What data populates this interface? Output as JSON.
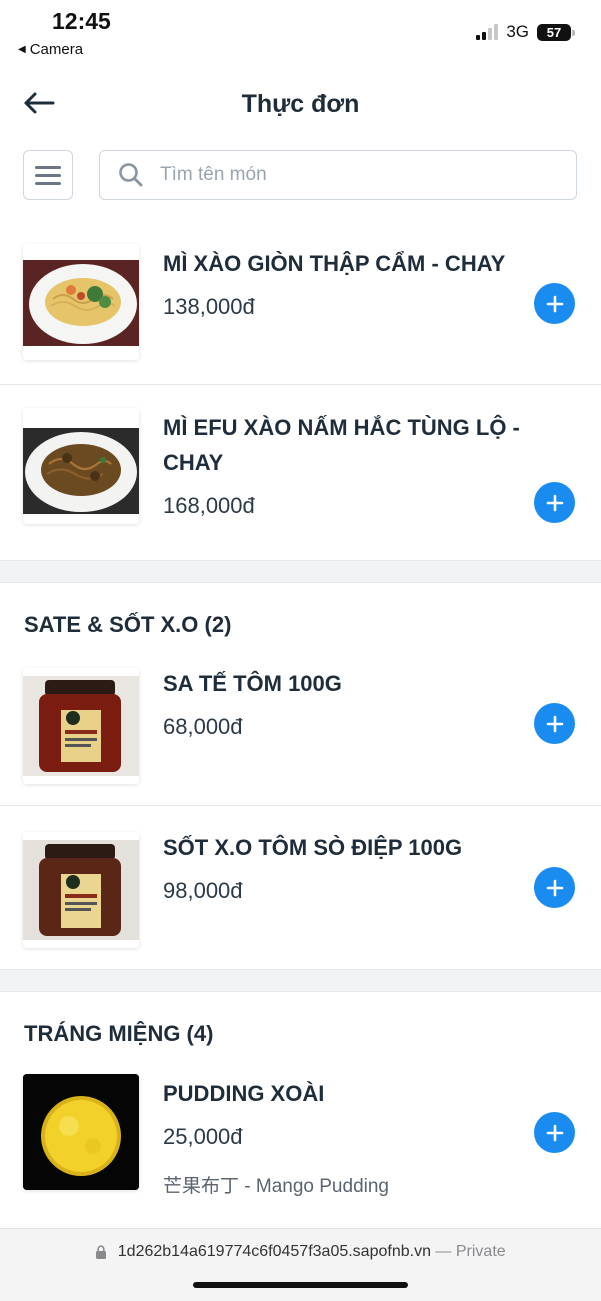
{
  "status_bar": {
    "time": "12:45",
    "back_app": "Camera",
    "network": "3G",
    "battery": "57"
  },
  "header": {
    "title": "Thực đơn"
  },
  "search": {
    "placeholder": "Tìm tên món",
    "value": ""
  },
  "items": [
    {
      "name": "MÌ XÀO GIÒN THẬP CẨM - CHAY",
      "price": "138,000đ",
      "image": "fried-crispy-noodles-photo"
    },
    {
      "name": "MÌ EFU XÀO NẤM HẮC TÙNG LỘ - CHAY",
      "price": "168,000đ",
      "image": "efu-noodles-truffle-photo"
    }
  ],
  "sections": [
    {
      "title": "SATE & SỐT X.O (2)",
      "items": [
        {
          "name": "SA TẾ TÔM 100G",
          "price": "68,000đ",
          "image": "shrimp-sate-jar-photo"
        },
        {
          "name": "SỐT X.O TÔM SÒ ĐIỆP 100G",
          "price": "98,000đ",
          "image": "xo-sauce-jar-photo"
        }
      ]
    },
    {
      "title": "TRÁNG MIỆNG (4)",
      "items": [
        {
          "name": "PUDDING XOÀI",
          "price": "25,000đ",
          "description": "芒果布丁 - Mango Pudding",
          "image": "mango-pudding-photo"
        }
      ]
    }
  ],
  "browser": {
    "url": "1d262b14a619774c6f0457f3a05.sapofnb.vn",
    "private_label": "— Private"
  },
  "colors": {
    "accent": "#1a8cf0",
    "text": "#1f2d3a",
    "border": "#cfd6dd"
  }
}
